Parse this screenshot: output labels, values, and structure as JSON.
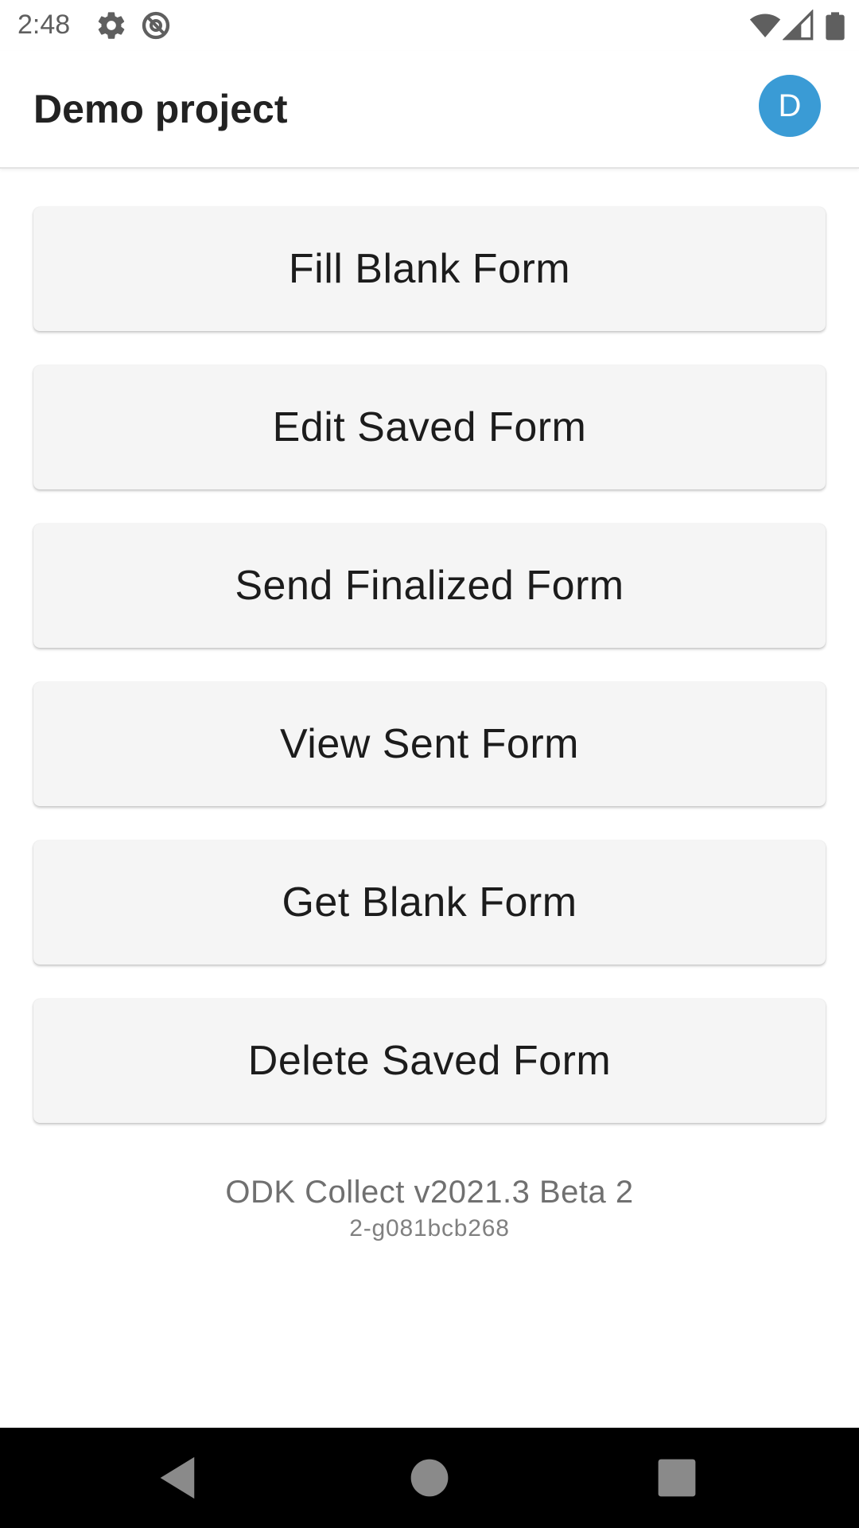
{
  "status_bar": {
    "time": "2:48",
    "icons": [
      "settings-gear-icon",
      "data-saver-icon",
      "wifi-icon",
      "cellular-signal-icon",
      "battery-icon"
    ]
  },
  "app_bar": {
    "title": "Demo project",
    "avatar_letter": "D",
    "avatar_color": "#3a9bd5"
  },
  "menu": {
    "buttons": [
      {
        "label": "Fill Blank Form"
      },
      {
        "label": "Edit Saved Form"
      },
      {
        "label": "Send Finalized Form"
      },
      {
        "label": "View Sent Form"
      },
      {
        "label": "Get Blank Form"
      },
      {
        "label": "Delete Saved Form"
      }
    ]
  },
  "version": {
    "name": "ODK Collect v2021.3 Beta 2",
    "build": "2-g081bcb268"
  },
  "nav_bar": {
    "icons": [
      "back-icon",
      "home-icon",
      "recents-icon"
    ]
  },
  "colors": {
    "button_bg": "#f5f5f5",
    "text_primary": "#1c1c1c",
    "text_secondary": "#707070",
    "nav_bar_bg": "#000000"
  }
}
